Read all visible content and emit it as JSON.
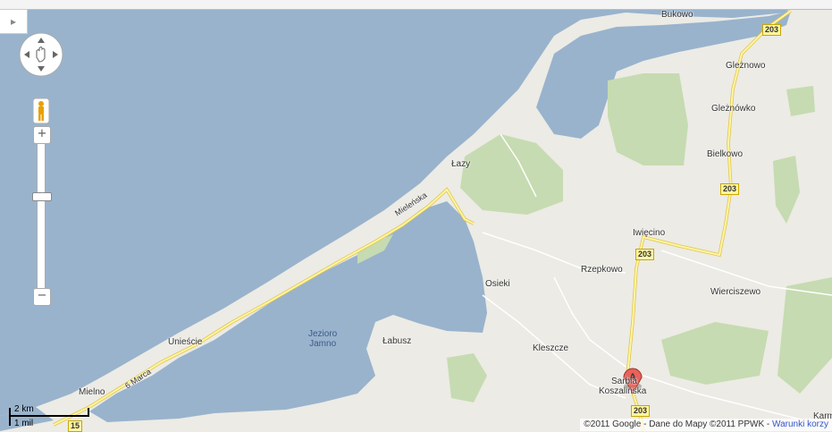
{
  "map": {
    "labels": {
      "bukowo": "Bukowo",
      "glezno": "Gleżnowo",
      "gleznowko": "Gleżnówko",
      "bielkowo": "Bielkowo",
      "lazy": "Łazy",
      "iwiecino": "Iwięcino",
      "rzepkowo": "Rzepkowo",
      "osieki": "Osieki",
      "wierciszewo": "Wierciszewo",
      "uniescie": "Unieście",
      "labusz": "Łabusz",
      "kleszcze": "Kleszcze",
      "mielno": "Mielno",
      "sarbia": "Sarbia",
      "koszalinska": "Koszalińska",
      "karm": "Karm",
      "jezioro": "Jezioro",
      "jamno": "Jamno",
      "mielenska": "Mieleńska",
      "marca": "6 Marca"
    },
    "shields": [
      "203",
      "203",
      "203",
      "203",
      "15"
    ],
    "marker_letter": "A"
  },
  "controls": {
    "zoom_in": "+",
    "zoom_out": "−",
    "toggle_glyph": "▸"
  },
  "scale": {
    "km": "2 km",
    "mi": "1 mil"
  },
  "footer": {
    "copyright": "©2011 Google - Dane do Mapy ©2011 PPWK - ",
    "terms_link": "Warunki korzy"
  },
  "colors": {
    "water": "#99b3cc",
    "land": "#ecebe5",
    "forest": "#c6dbb1",
    "road": "#fff6a0",
    "road_border": "#e0c34a"
  }
}
